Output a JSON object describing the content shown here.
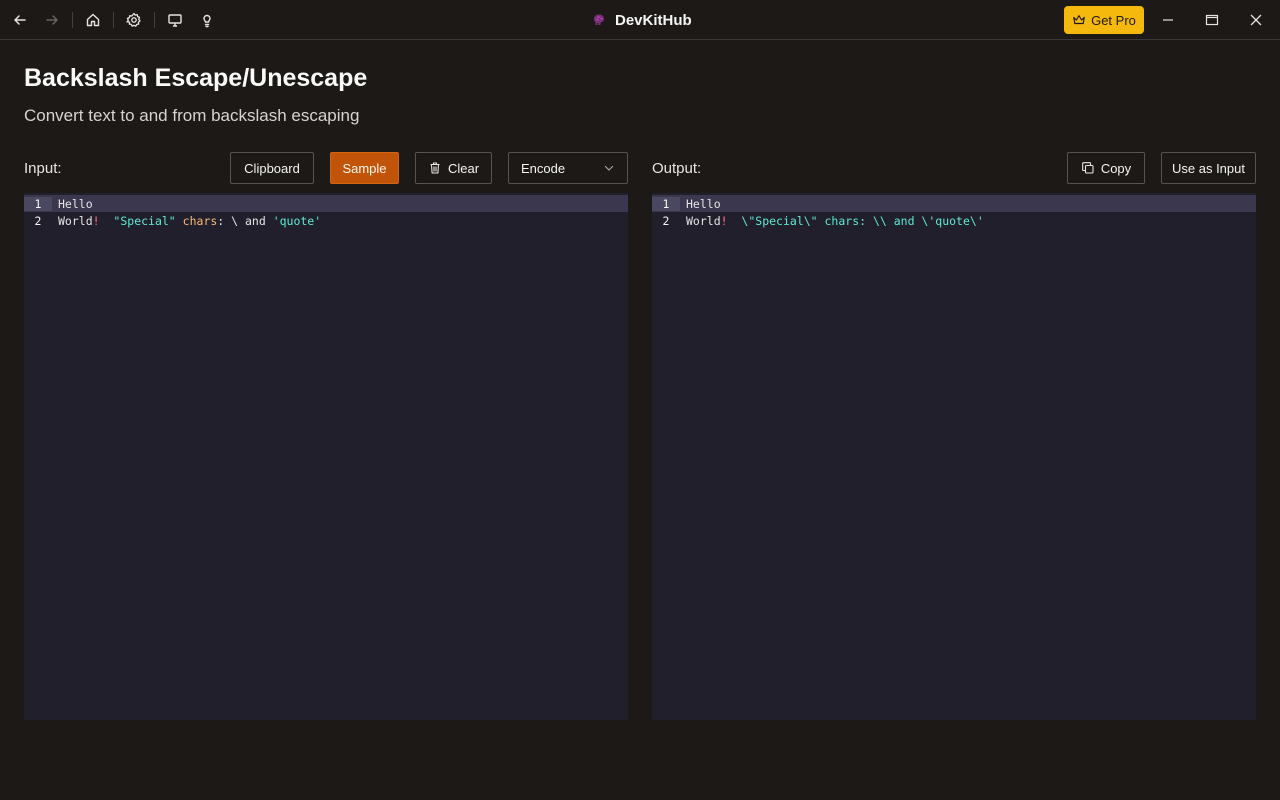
{
  "titlebar": {
    "app_name": "DevKitHub",
    "get_pro_label": "Get Pro"
  },
  "page": {
    "title": "Backslash Escape/Unescape",
    "subtitle": "Convert text to and from backslash escaping"
  },
  "input_panel": {
    "label": "Input:",
    "buttons": {
      "clipboard": "Clipboard",
      "sample": "Sample",
      "clear": "Clear"
    },
    "mode_select": "Encode",
    "lines": [
      {
        "number": "1",
        "tokens": [
          {
            "text": "Hello",
            "kind": "plain"
          }
        ]
      },
      {
        "number": "2",
        "tokens": [
          {
            "text": "World",
            "kind": "plain"
          },
          {
            "text": "!",
            "kind": "punct"
          },
          {
            "text": "  ",
            "kind": "plain"
          },
          {
            "text": "\"Special\"",
            "kind": "str"
          },
          {
            "text": " ",
            "kind": "plain"
          },
          {
            "text": "chars",
            "kind": "id"
          },
          {
            "text": ": \\ and ",
            "kind": "plain"
          },
          {
            "text": "'quote'",
            "kind": "str"
          }
        ]
      }
    ]
  },
  "output_panel": {
    "label": "Output:",
    "buttons": {
      "copy": "Copy",
      "use_as_input": "Use as Input"
    },
    "lines": [
      {
        "number": "1",
        "tokens": [
          {
            "text": "Hello",
            "kind": "plain"
          }
        ]
      },
      {
        "number": "2",
        "tokens": [
          {
            "text": "World",
            "kind": "plain"
          },
          {
            "text": "!",
            "kind": "punct"
          },
          {
            "text": "  ",
            "kind": "plain"
          },
          {
            "text": "\\\"Special\\\" chars: \\\\ and \\'quote\\'",
            "kind": "str"
          }
        ]
      }
    ]
  },
  "colors": {
    "accent": "#c2540a",
    "pro": "#f5b80c",
    "editor_bg": "#211f2c",
    "string": "#5eead4",
    "identifier": "#fdba74",
    "punctuation": "#fb7185"
  }
}
